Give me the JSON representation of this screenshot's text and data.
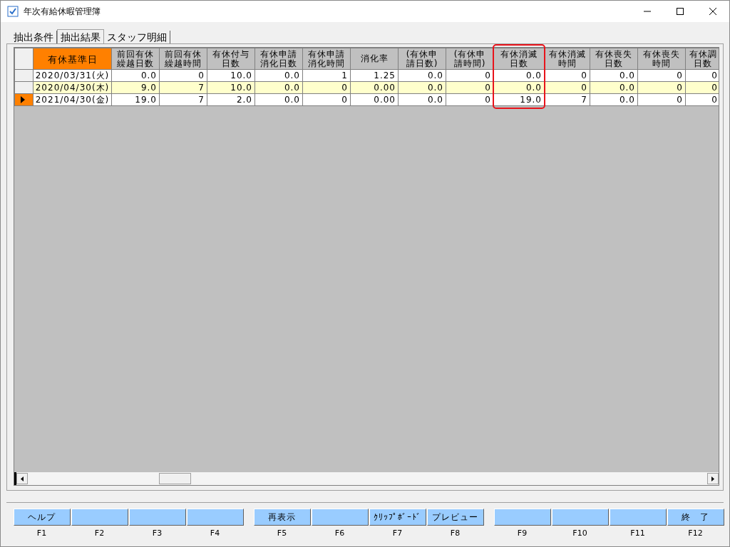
{
  "window": {
    "title": "年次有給休暇管理簿"
  },
  "tabs": [
    {
      "label": "抽出条件",
      "selected": false
    },
    {
      "label": "抽出結果",
      "selected": true
    },
    {
      "label": "スタッフ明細",
      "selected": false
    }
  ],
  "table": {
    "columns": [
      {
        "label": "有休基準日",
        "key": true,
        "highlighted": false
      },
      {
        "label": "前回有休繰越日数",
        "key": false,
        "highlighted": false
      },
      {
        "label": "前回有休繰越時間",
        "key": false,
        "highlighted": false
      },
      {
        "label": "有休付与日数",
        "key": false,
        "highlighted": false
      },
      {
        "label": "有休申請消化日数",
        "key": false,
        "highlighted": false
      },
      {
        "label": "有休申請消化時間",
        "key": false,
        "highlighted": false
      },
      {
        "label": "消化率",
        "key": false,
        "highlighted": false
      },
      {
        "label": "(有休申請日数)",
        "key": false,
        "highlighted": false
      },
      {
        "label": "(有休申請時間)",
        "key": false,
        "highlighted": false
      },
      {
        "label": "有休消滅日数",
        "key": false,
        "highlighted": true
      },
      {
        "label": "有休消滅時間",
        "key": false,
        "highlighted": false
      },
      {
        "label": "有休喪失日数",
        "key": false,
        "highlighted": false
      },
      {
        "label": "有休喪失時間",
        "key": false,
        "highlighted": false
      },
      {
        "label": "有休調日数",
        "key": false,
        "highlighted": false
      }
    ],
    "rows": [
      {
        "selected": false,
        "shaded": false,
        "cells": [
          "2020/03/31(火)",
          "0.0",
          "0",
          "10.0",
          "0.0",
          "1",
          "1.25",
          "0.0",
          "0",
          "0.0",
          "0",
          "0.0",
          "0",
          "0"
        ]
      },
      {
        "selected": false,
        "shaded": true,
        "cells": [
          "2020/04/30(木)",
          "9.0",
          "7",
          "10.0",
          "0.0",
          "0",
          "0.00",
          "0.0",
          "0",
          "0.0",
          "0",
          "0.0",
          "0",
          "0"
        ]
      },
      {
        "selected": true,
        "shaded": false,
        "cells": [
          "2021/04/30(金)",
          "19.0",
          "7",
          "2.0",
          "0.0",
          "0",
          "0.00",
          "0.0",
          "0",
          "19.0",
          "7",
          "0.0",
          "0",
          "0"
        ]
      }
    ]
  },
  "function_keys": [
    {
      "label": "ヘルプ",
      "key": "F1"
    },
    {
      "key": "F2"
    },
    {
      "key": "F3"
    },
    {
      "key": "F4"
    },
    {
      "label": "再表示",
      "key": "F5"
    },
    {
      "key": "F6"
    },
    {
      "label": "ｸﾘｯﾌﾟﾎﾞｰﾄﾞ",
      "key": "F7"
    },
    {
      "label": "プレビュー",
      "key": "F8"
    },
    {
      "key": "F9"
    },
    {
      "key": "F10"
    },
    {
      "key": "F11"
    },
    {
      "label": "終　了",
      "key": "F12"
    }
  ]
}
